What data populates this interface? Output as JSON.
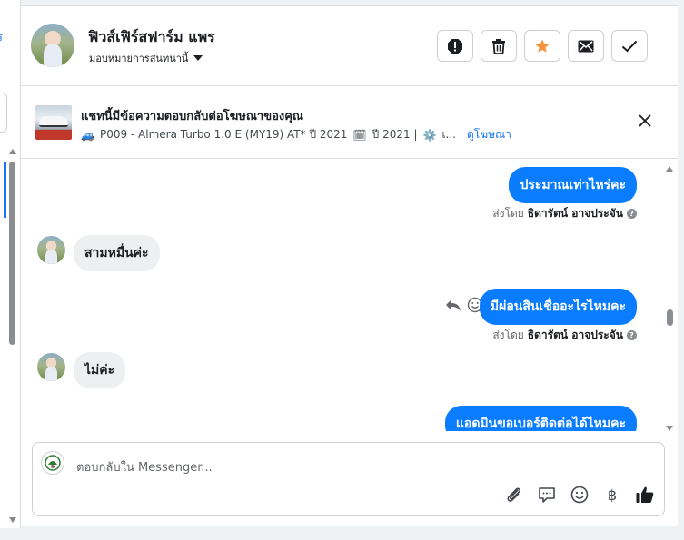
{
  "left_pane": {
    "clipped_text": "ร"
  },
  "header": {
    "contact_name": "ฟิวส์เฟิร์สฟาร์ม แพร",
    "assign_label": "มอบหมายการสนทนานี้"
  },
  "actions": {
    "items": [
      {
        "name": "alert-icon"
      },
      {
        "name": "trash-icon"
      },
      {
        "name": "star-icon",
        "color": "#f7923a"
      },
      {
        "name": "mail-icon"
      },
      {
        "name": "check-icon"
      }
    ]
  },
  "ad": {
    "title": "แชทนี้มีข้อความตอบกลับต่อโฆษณาของคุณ",
    "car_emoji": "🚙",
    "details": "P009 - Almera Turbo 1.0 E (MY19) AT* ปี 2021",
    "calendar_emoji": "🗓",
    "year": "ปี 2021 |",
    "gear_emoji": "⚙️",
    "ellipsis": "เ...",
    "view_ad_link": "ดูโฆษณา"
  },
  "messages": [
    {
      "direction": "out",
      "text": "ประมาณเท่าไหร่คะ"
    },
    {
      "direction": "meta",
      "prefix": "ส่งโดย",
      "sender": "ธิดารัตน์ อาจประจัน"
    },
    {
      "direction": "in",
      "text": "สามหมื่นค่ะ"
    },
    {
      "direction": "out",
      "text": "มีผ่อนสินเชื่ออะไรไหมคะ"
    },
    {
      "direction": "meta",
      "prefix": "ส่งโดย",
      "sender": "ธิดารัตน์ อาจประจัน"
    },
    {
      "direction": "in",
      "text": "ไม่ค่ะ"
    },
    {
      "direction": "out",
      "text": "แอดมินขอเบอร์ติดต่อได้ไหมคะ"
    }
  ],
  "composer": {
    "placeholder": "ตอบกลับใน Messenger...",
    "tools": [
      "paperclip-icon",
      "chat-bubble-icon",
      "emoji-icon",
      "baht-icon",
      "thumbs-up-icon"
    ],
    "baht_symbol": "฿"
  },
  "colors": {
    "accent": "#0a7cff",
    "link": "#1877f2",
    "star": "#f7923a"
  }
}
